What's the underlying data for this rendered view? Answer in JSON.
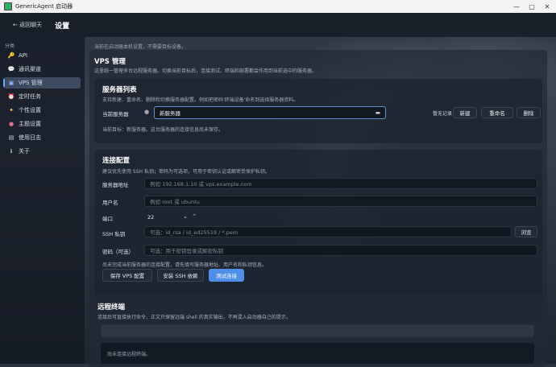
{
  "window": {
    "title": "GenericAgent 启动器",
    "controls": [
      "—",
      "▢",
      "✕"
    ]
  },
  "header": {
    "back_label": "← 返回聊天",
    "title": "设置"
  },
  "sidebar": {
    "group": "分类",
    "items": [
      {
        "label": "API",
        "icon": "key-icon"
      },
      {
        "label": "通讯渠道",
        "icon": "chat-icon"
      },
      {
        "label": "VPS 管理",
        "icon": "server-icon",
        "active": true
      },
      {
        "label": "定时任务",
        "icon": "alarm-icon"
      },
      {
        "label": "个性设置",
        "icon": "sparkle-icon"
      },
      {
        "label": "主题设置",
        "icon": "palette-icon"
      },
      {
        "label": "使用日志",
        "icon": "log-icon"
      },
      {
        "label": "关于",
        "icon": "info-icon"
      }
    ]
  },
  "main": {
    "hint": "当前在启动器本机设置，不需要目标设备。",
    "vps": {
      "title": "VPS 管理",
      "desc": "这里统一管理多台远程服务器。切换当前目标后，连接测试、终端和部署都会作用到当前选中的服务器。"
    },
    "server_list": {
      "title": "服务器列表",
      "desc": "支持新建、重命名、删除和切换服务器配置。例如把密码'终端设备'命名到选择服务器资料。",
      "current_label": "当前服务器",
      "current_value": "新服务器",
      "unsaved": "暂无记录",
      "new_btn": "新建",
      "rename_btn": "重命名",
      "delete_btn": "删除",
      "footer": "当前目标：新服务器。这台服务器的连接信息尚未保存。"
    },
    "connection": {
      "title": "连接配置",
      "desc": "建议优先使用 SSH 私钥；密码为可选项，可用于密钥认证或解密受保护私钥。",
      "host_label": "服务器地址",
      "host_placeholder": "例如 192.168.1.10 或 vps.example.com",
      "user_label": "用户名",
      "user_placeholder": "例如 root 或 ubuntu",
      "port_label": "端口",
      "port_value": "22",
      "key_label": "SSH 私钥",
      "key_placeholder": "可选：id_rsa / id_ed25519 / *.pem",
      "browse_btn": "浏览",
      "pwd_label": "密码（可选）",
      "pwd_placeholder": "可选：用于密钥登录或解密私钥",
      "footer": "尚未完成当前服务器的连接配置，请先填写服务器地址、用户名和私钥信息。",
      "save_btn": "保存 VPS 配置",
      "install_btn": "安装 SSH 依赖",
      "test_btn": "测试连接"
    },
    "terminal": {
      "title": "远程终端",
      "desc": "连接后可直接执行命令，正文只保留远端 shell 的真实输出，不再混入启动器自己的提示。",
      "status": "尚未连接远程终端。"
    }
  }
}
